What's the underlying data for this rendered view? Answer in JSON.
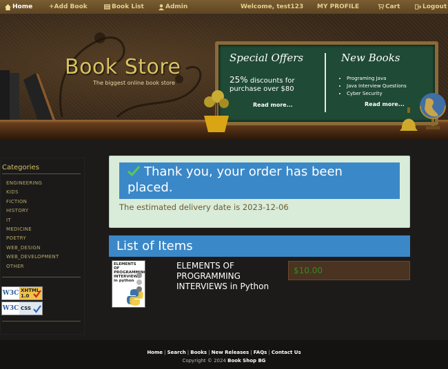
{
  "nav": {
    "home": "Home",
    "add_book": "+Add Book",
    "book_list": "Book List",
    "admin": "Admin",
    "welcome": "Welcome, test123",
    "profile": "MY PROFILE",
    "cart": "Cart",
    "logout": "Logout"
  },
  "banner": {
    "store_title": "Book Store",
    "store_subtitle": "The biggest online book store",
    "offers_title": "Special Offers",
    "offer_big": "25%",
    "offer_rest": " discounts for purchase over $80",
    "offers_read_more": "Read more...",
    "new_books_title": "New Books",
    "new_books": [
      "Programing Java",
      "Java Interview Questions",
      "Cyber Security"
    ],
    "new_books_read_more": "Read more..."
  },
  "sidebar": {
    "title": "Categories",
    "categories": [
      "ENGINEERING",
      "KIDS",
      "FICTION",
      "HISTORY",
      "IT",
      "MEDICINE",
      "POETRY",
      "WEB_DESIGN",
      "WEB_DEVELOPMENT",
      "OTHER"
    ],
    "badge_xhtml": "XHTML 1.0",
    "badge_css": "CSS",
    "badge_w3c": "W3C"
  },
  "order": {
    "message": "Thank you, your order has been placed.",
    "delivery": "The estimated delivery date is 2023-12-06"
  },
  "items": {
    "heading": "List of Items",
    "list": [
      {
        "title": "ELEMENTS OF PROGRAMMING INTERVIEWS in Python",
        "cover_text": "ELEMENTS OF PROGRAMMING INTERVIEWS in python",
        "price": "$10.00"
      }
    ]
  },
  "footer": {
    "links": [
      "Home",
      "Search",
      "Books",
      "New Releases",
      "FAQs",
      "Contact Us"
    ],
    "copyright": "Copyright © 2024",
    "brand": "Book Shop BG"
  },
  "colors": {
    "accent_blue": "#3b88c8",
    "gold": "#d8c262",
    "success_bg": "#d9ecda",
    "price_green": "#2f8c26"
  }
}
